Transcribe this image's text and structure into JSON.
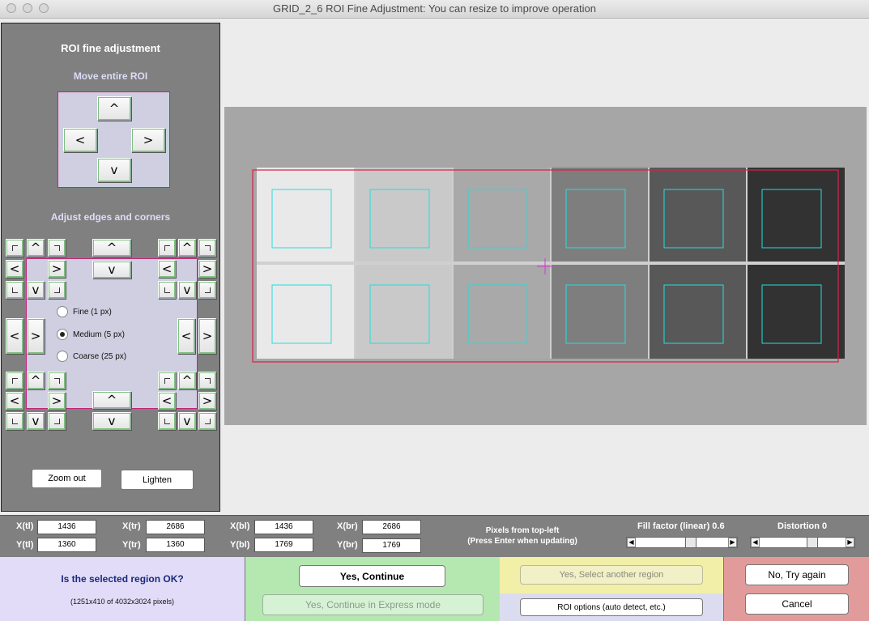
{
  "window": {
    "title": "GRID_2_6 ROI Fine Adjustment: You can resize to improve operation"
  },
  "left_panel": {
    "title": "ROI fine adjustment",
    "move_label": "Move entire ROI",
    "adjust_label": "Adjust edges and corners",
    "arrows": {
      "up": "^",
      "down": "v",
      "left": "<",
      "right": ">"
    },
    "step_options": [
      "Fine (1 px)",
      "Medium (5 px)",
      "Coarse (25 px)"
    ],
    "selected_step": "Medium (5 px)",
    "zoom_out_label": "Zoom out",
    "lighten_label": "Lighten"
  },
  "coords": {
    "x_tl_label": "X(tl)",
    "x_tl": "1436",
    "y_tl_label": "Y(tl)",
    "y_tl": "1360",
    "x_tr_label": "X(tr)",
    "x_tr": "2686",
    "y_tr_label": "Y(tr)",
    "y_tr": "1360",
    "x_bl_label": "X(bl)",
    "x_bl": "1436",
    "y_bl_label": "Y(bl)",
    "y_bl": "1769",
    "x_br_label": "X(br)",
    "x_br": "2686",
    "y_br_label": "Y(br)",
    "y_br": "1769",
    "pixels_note_1": "Pixels from top-left",
    "pixels_note_2": "(Press Enter when updating)",
    "fill_factor_label": "Fill factor (linear) 0.6",
    "fill_factor_value": 0.6,
    "distortion_label": "Distortion 0",
    "distortion_value": 0
  },
  "bottom": {
    "question": "Is the selected region OK?",
    "region_info": "(1251x410 of 4032x3024 pixels)",
    "yes_continue": "Yes, Continue",
    "yes_express": "Yes, Continue in Express mode",
    "yes_another": "Yes, Select another region",
    "roi_options": "ROI options (auto detect, etc.)",
    "no_try_again": "No, Try again",
    "cancel": "Cancel"
  },
  "colors": {
    "roi_outline": "#d8204a",
    "patch_outline": "#1fe0e0",
    "crosshair": "#d03cd0",
    "ok_panel": "#e2dcf8",
    "continue_panel": "#b5e8b1",
    "another_panel": "#f2f0a8",
    "options_panel": "#dcdcf0",
    "try_panel": "#e29b9b"
  },
  "patches": {
    "top_row": [
      "#e9e9e9",
      "#c9c9c9",
      "#a9a9a9",
      "#7e7e7e",
      "#585858",
      "#323232"
    ],
    "bottom_row": [
      "#e9e9e9",
      "#c9c9c9",
      "#a9a9a9",
      "#7e7e7e",
      "#585858",
      "#323232"
    ]
  }
}
